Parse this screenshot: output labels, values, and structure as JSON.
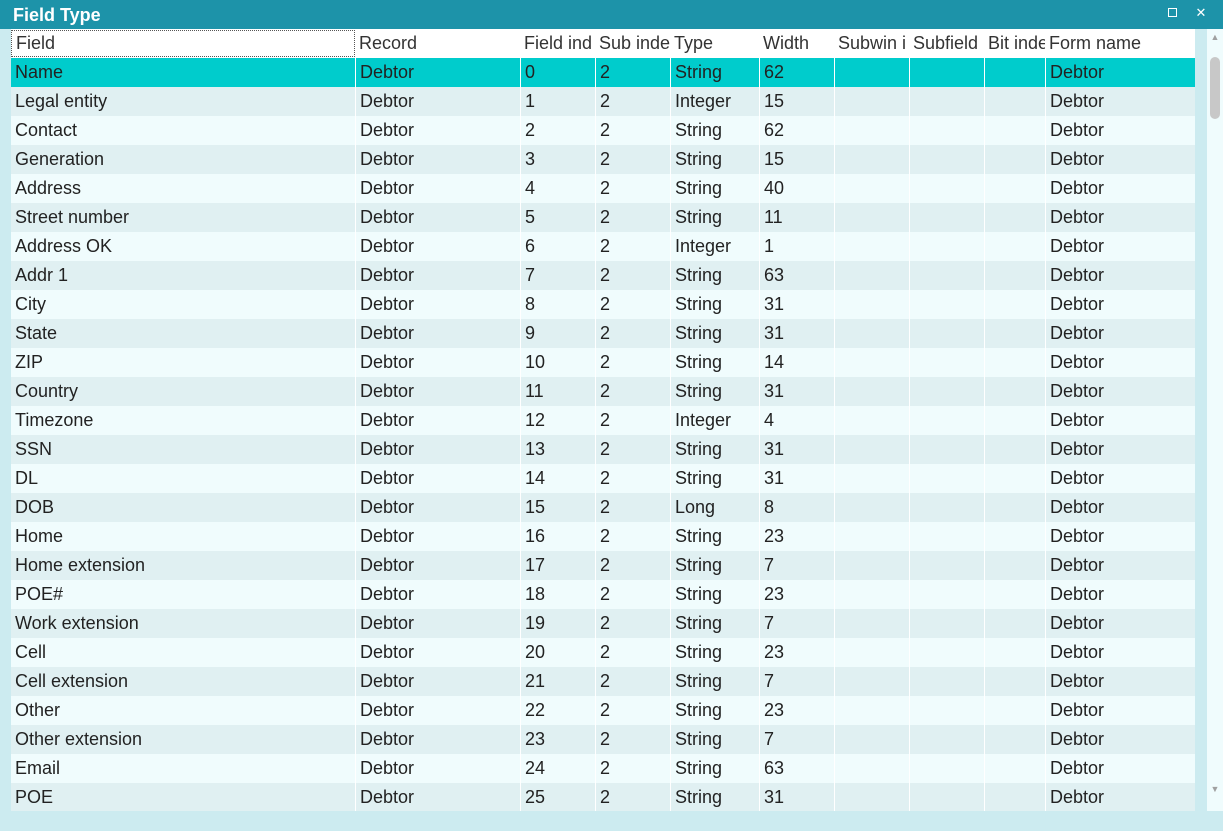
{
  "window": {
    "title": "Field Type",
    "maximize_icon": "maximize-icon",
    "close_icon": "close-icon",
    "close_glyph": "✕"
  },
  "colors": {
    "titlebar": "#1d93a9",
    "selected_row": "#00cccc",
    "row_even": "#f0fcfd",
    "row_odd": "#e0f0f2"
  },
  "table": {
    "columns": [
      "Field",
      "Record",
      "Field ind",
      "Sub inde",
      "Type",
      "Width",
      "Subwin i",
      "Subfield",
      "Bit inde",
      "Form name"
    ],
    "selected_index": 0,
    "rows": [
      [
        "Name",
        "Debtor",
        "0",
        "2",
        "String",
        "62",
        "",
        "",
        "",
        "Debtor"
      ],
      [
        "Legal entity",
        "Debtor",
        "1",
        "2",
        "Integer",
        "15",
        "",
        "",
        "",
        "Debtor"
      ],
      [
        "Contact",
        "Debtor",
        "2",
        "2",
        "String",
        "62",
        "",
        "",
        "",
        "Debtor"
      ],
      [
        "Generation",
        "Debtor",
        "3",
        "2",
        "String",
        "15",
        "",
        "",
        "",
        "Debtor"
      ],
      [
        "Address",
        "Debtor",
        "4",
        "2",
        "String",
        "40",
        "",
        "",
        "",
        "Debtor"
      ],
      [
        "Street number",
        "Debtor",
        "5",
        "2",
        "String",
        "11",
        "",
        "",
        "",
        "Debtor"
      ],
      [
        "Address OK",
        "Debtor",
        "6",
        "2",
        "Integer",
        "1",
        "",
        "",
        "",
        "Debtor"
      ],
      [
        "Addr 1",
        "Debtor",
        "7",
        "2",
        "String",
        "63",
        "",
        "",
        "",
        "Debtor"
      ],
      [
        "City",
        "Debtor",
        "8",
        "2",
        "String",
        "31",
        "",
        "",
        "",
        "Debtor"
      ],
      [
        "State",
        "Debtor",
        "9",
        "2",
        "String",
        "31",
        "",
        "",
        "",
        "Debtor"
      ],
      [
        "ZIP",
        "Debtor",
        "10",
        "2",
        "String",
        "14",
        "",
        "",
        "",
        "Debtor"
      ],
      [
        "Country",
        "Debtor",
        "11",
        "2",
        "String",
        "31",
        "",
        "",
        "",
        "Debtor"
      ],
      [
        "Timezone",
        "Debtor",
        "12",
        "2",
        "Integer",
        "4",
        "",
        "",
        "",
        "Debtor"
      ],
      [
        "SSN",
        "Debtor",
        "13",
        "2",
        "String",
        "31",
        "",
        "",
        "",
        "Debtor"
      ],
      [
        "DL",
        "Debtor",
        "14",
        "2",
        "String",
        "31",
        "",
        "",
        "",
        "Debtor"
      ],
      [
        "DOB",
        "Debtor",
        "15",
        "2",
        "Long",
        "8",
        "",
        "",
        "",
        "Debtor"
      ],
      [
        "Home",
        "Debtor",
        "16",
        "2",
        "String",
        "23",
        "",
        "",
        "",
        "Debtor"
      ],
      [
        "Home extension",
        "Debtor",
        "17",
        "2",
        "String",
        "7",
        "",
        "",
        "",
        "Debtor"
      ],
      [
        "POE#",
        "Debtor",
        "18",
        "2",
        "String",
        "23",
        "",
        "",
        "",
        "Debtor"
      ],
      [
        "Work extension",
        "Debtor",
        "19",
        "2",
        "String",
        "7",
        "",
        "",
        "",
        "Debtor"
      ],
      [
        "Cell",
        "Debtor",
        "20",
        "2",
        "String",
        "23",
        "",
        "",
        "",
        "Debtor"
      ],
      [
        "Cell extension",
        "Debtor",
        "21",
        "2",
        "String",
        "7",
        "",
        "",
        "",
        "Debtor"
      ],
      [
        "Other",
        "Debtor",
        "22",
        "2",
        "String",
        "23",
        "",
        "",
        "",
        "Debtor"
      ],
      [
        "Other extension",
        "Debtor",
        "23",
        "2",
        "String",
        "7",
        "",
        "",
        "",
        "Debtor"
      ],
      [
        "Email",
        "Debtor",
        "24",
        "2",
        "String",
        "63",
        "",
        "",
        "",
        "Debtor"
      ],
      [
        "POE",
        "Debtor",
        "25",
        "2",
        "String",
        "31",
        "",
        "",
        "",
        "Debtor"
      ]
    ]
  },
  "scrollbar": {
    "up_icon": "scroll-up-arrow-icon",
    "down_icon": "scroll-down-arrow-icon",
    "up_glyph": "▲",
    "down_glyph": "▼"
  }
}
